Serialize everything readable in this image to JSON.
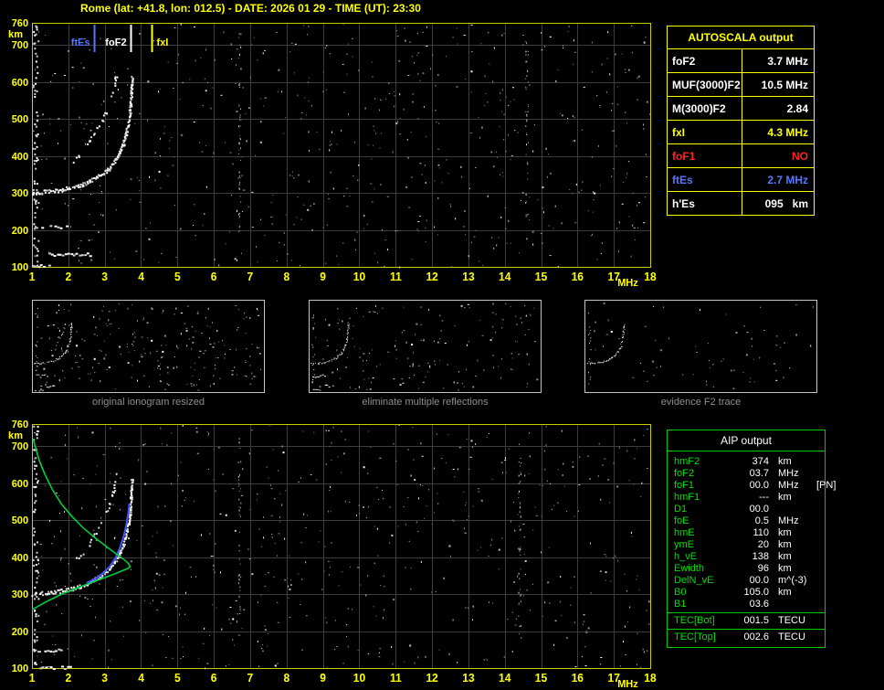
{
  "title": "Rome (lat: +41.8, lon: 012.5) - DATE: 2026 01 29 - TIME (UT): 23:30",
  "colors": {
    "background": "#000000",
    "axis_yellow": "#ffff00",
    "grid": "#3c3c3c",
    "frame": "#cccc00",
    "green_border": "#00cc00",
    "blue": "#5577ff",
    "red": "#ff2222",
    "profile_green": "#00cc44",
    "model_blue": "#4455ff"
  },
  "autoscala_table": {
    "header": "AUTOSCALA output",
    "rows": [
      {
        "label": "foF2",
        "value": "3.7 MHz",
        "color": "#ffffff"
      },
      {
        "label": "MUF(3000)F2",
        "value": "10.5 MHz",
        "color": "#ffffff"
      },
      {
        "label": "M(3000)F2",
        "value": "2.84",
        "color": "#ffffff"
      },
      {
        "label": "fxI",
        "value": "4.3 MHz",
        "color": "#ffff00"
      },
      {
        "label": "foF1",
        "value": "NO",
        "color": "#ff2222"
      },
      {
        "label": "ftEs",
        "value": "2.7 MHz",
        "color": "#5577ff"
      },
      {
        "label": "h'Es",
        "value": "095   km",
        "color": "#ffffff"
      }
    ]
  },
  "aip_table": {
    "header": "AIP output",
    "rows": [
      {
        "label": "hmF2",
        "value": "374",
        "unit": "km",
        "note": ""
      },
      {
        "label": "foF2",
        "value": "03.7",
        "unit": "MHz",
        "note": ""
      },
      {
        "label": "foF1",
        "value": "00.0",
        "unit": "MHz",
        "note": "[PN]"
      },
      {
        "label": "hmF1",
        "value": "---",
        "unit": "km",
        "note": ""
      },
      {
        "label": "D1",
        "value": "00.0",
        "unit": "",
        "note": ""
      },
      {
        "label": "foE",
        "value": "0.5",
        "unit": "MHz",
        "note": ""
      },
      {
        "label": "hmE",
        "value": "110",
        "unit": "km",
        "note": ""
      },
      {
        "label": "ymE",
        "value": "20",
        "unit": "km",
        "note": ""
      },
      {
        "label": "h_vE",
        "value": "138",
        "unit": "km",
        "note": ""
      },
      {
        "label": "Ewidth",
        "value": "96",
        "unit": "km",
        "note": ""
      },
      {
        "label": "DelN_vE",
        "value": "00.0",
        "unit": "m^(-3)",
        "note": ""
      },
      {
        "label": "B0",
        "value": "105.0",
        "unit": "km",
        "note": ""
      },
      {
        "label": "B1",
        "value": "03.6",
        "unit": "",
        "note": ""
      }
    ],
    "tec_rows": [
      {
        "label": "TEC[Bot]",
        "value": "001.5",
        "unit": "TECU",
        "note": ""
      },
      {
        "label": "TEC[Top]",
        "value": "002.6",
        "unit": "TECU",
        "note": ""
      }
    ]
  },
  "thumbnails": [
    {
      "caption": "original ionogram resized",
      "show_series": [
        "F2 trace",
        "multiple reflection",
        "sporadic E"
      ],
      "noise_points": 230
    },
    {
      "caption": "eliminate multiple reflections",
      "show_series": [
        "F2 trace",
        "sporadic E"
      ],
      "noise_points": 160
    },
    {
      "caption": "evidence F2 trace",
      "show_series": [
        "F2 trace"
      ],
      "noise_points": 70
    }
  ],
  "chart_data": [
    {
      "id": "main_ionogram",
      "type": "scatter",
      "title": "scaled ionogram",
      "xlabel": "MHz",
      "ylabel": "km",
      "xlim": [
        1,
        18
      ],
      "ylim": [
        100,
        760
      ],
      "x_ticks": [
        1,
        2,
        3,
        4,
        5,
        6,
        7,
        8,
        9,
        10,
        11,
        12,
        13,
        14,
        15,
        16,
        17,
        18
      ],
      "y_ticks": [
        760,
        700,
        600,
        500,
        400,
        300,
        200,
        100
      ],
      "grid": true,
      "markers": [
        {
          "name": "ftEs",
          "freq": 2.7,
          "color": "#5577ff",
          "label_side": "left"
        },
        {
          "name": "foF2",
          "freq": 3.7,
          "color": "#ffffff",
          "label_side": "left"
        },
        {
          "name": "fxI",
          "freq": 4.3,
          "color": "#ffff00",
          "label_side": "right"
        }
      ],
      "series": [
        {
          "name": "F2 trace",
          "color": "#ffffff",
          "points": [
            [
              1.0,
              302
            ],
            [
              1.3,
              304
            ],
            [
              1.6,
              307
            ],
            [
              1.9,
              312
            ],
            [
              2.2,
              319
            ],
            [
              2.5,
              329
            ],
            [
              2.7,
              339
            ],
            [
              2.9,
              351
            ],
            [
              3.1,
              367
            ],
            [
              3.25,
              386
            ],
            [
              3.4,
              410
            ],
            [
              3.5,
              436
            ],
            [
              3.58,
              463
            ],
            [
              3.64,
              492
            ],
            [
              3.68,
              522
            ],
            [
              3.71,
              556
            ],
            [
              3.73,
              592
            ],
            [
              3.74,
              618
            ]
          ]
        },
        {
          "name": "multiple reflection",
          "color": "#dddddd",
          "faint": true,
          "points": [
            [
              2.1,
              385
            ],
            [
              2.35,
              410
            ],
            [
              2.6,
              445
            ],
            [
              2.8,
              478
            ],
            [
              3.0,
              515
            ],
            [
              3.15,
              552
            ],
            [
              3.25,
              592
            ],
            [
              3.32,
              628
            ]
          ]
        },
        {
          "name": "sporadic E",
          "color": "#ffffff",
          "segments": [
            [
              1.0,
              1.6,
              105
            ],
            [
              1.45,
              2.6,
              135
            ],
            [
              1.1,
              2.0,
              210
            ]
          ]
        }
      ],
      "noise_points": 620,
      "interference_freqs": [
        6.7,
        14.6
      ]
    },
    {
      "id": "aip_ionogram",
      "type": "scatter",
      "title": "AIP profile over ionogram",
      "xlabel": "MHz",
      "ylabel": "km",
      "xlim": [
        1,
        18
      ],
      "ylim": [
        100,
        760
      ],
      "x_ticks": [
        1,
        2,
        3,
        4,
        5,
        6,
        7,
        8,
        9,
        10,
        11,
        12,
        13,
        14,
        15,
        16,
        17,
        18
      ],
      "y_ticks": [
        760,
        700,
        600,
        500,
        400,
        300,
        200,
        100
      ],
      "grid": true,
      "series": [
        {
          "name": "F2 trace",
          "color": "#ffffff",
          "points": [
            [
              1.0,
              302
            ],
            [
              1.3,
              304
            ],
            [
              1.6,
              307
            ],
            [
              1.9,
              312
            ],
            [
              2.2,
              319
            ],
            [
              2.5,
              329
            ],
            [
              2.7,
              339
            ],
            [
              2.9,
              351
            ],
            [
              3.1,
              367
            ],
            [
              3.25,
              386
            ],
            [
              3.4,
              410
            ],
            [
              3.5,
              436
            ],
            [
              3.58,
              463
            ],
            [
              3.64,
              492
            ],
            [
              3.68,
              522
            ],
            [
              3.71,
              556
            ],
            [
              3.73,
              592
            ],
            [
              3.74,
              618
            ]
          ]
        },
        {
          "name": "multiple reflection",
          "color": "#bbbbbb",
          "faint": true,
          "points": [
            [
              2.1,
              385
            ],
            [
              2.35,
              410
            ],
            [
              2.6,
              445
            ],
            [
              2.8,
              478
            ],
            [
              3.0,
              515
            ],
            [
              3.15,
              552
            ],
            [
              3.25,
              592
            ],
            [
              3.32,
              628
            ]
          ]
        },
        {
          "name": "sporadic E",
          "color": "#ffffff",
          "segments": [
            [
              1.2,
              2.1,
              103
            ],
            [
              1.1,
              1.9,
              150
            ]
          ]
        },
        {
          "name": "model trace",
          "color": "#4455ff",
          "line": true,
          "width": 2,
          "points": [
            [
              2.5,
              330
            ],
            [
              2.75,
              342
            ],
            [
              2.95,
              356
            ],
            [
              3.15,
              376
            ],
            [
              3.3,
              398
            ],
            [
              3.42,
              425
            ],
            [
              3.52,
              455
            ],
            [
              3.6,
              490
            ],
            [
              3.65,
              520
            ],
            [
              3.68,
              545
            ]
          ]
        },
        {
          "name": "electron density profile",
          "color": "#00cc44",
          "line": true,
          "width": 1.6,
          "points": [
            [
              1.0,
              258
            ],
            [
              1.4,
              280
            ],
            [
              1.8,
              299
            ],
            [
              2.2,
              315
            ],
            [
              2.6,
              330
            ],
            [
              3.0,
              345
            ],
            [
              3.3,
              356
            ],
            [
              3.5,
              364
            ],
            [
              3.65,
              370
            ],
            [
              3.7,
              374
            ],
            [
              3.65,
              383
            ],
            [
              3.5,
              396
            ],
            [
              3.3,
              410
            ],
            [
              3.0,
              432
            ],
            [
              2.7,
              455
            ],
            [
              2.4,
              480
            ],
            [
              2.1,
              510
            ],
            [
              1.8,
              545
            ],
            [
              1.55,
              585
            ],
            [
              1.35,
              625
            ],
            [
              1.2,
              662
            ],
            [
              1.1,
              695
            ],
            [
              1.03,
              720
            ]
          ]
        }
      ],
      "noise_points": 620,
      "interference_freqs": [
        6.7,
        14.4
      ]
    }
  ]
}
